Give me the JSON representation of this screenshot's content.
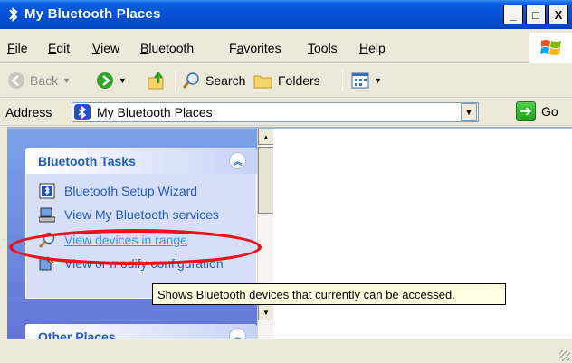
{
  "window": {
    "title": "My Bluetooth Places",
    "controls": {
      "minimize": "_",
      "maximize": "□",
      "close": "X"
    }
  },
  "menu": [
    {
      "label": "File",
      "underline": "F"
    },
    {
      "label": "Edit",
      "underline": "E"
    },
    {
      "label": "View",
      "underline": "V"
    },
    {
      "label": "Bluetooth",
      "underline": "B"
    },
    {
      "label": "Favorites",
      "underline": "a"
    },
    {
      "label": "Tools",
      "underline": "T"
    },
    {
      "label": "Help",
      "underline": "H"
    }
  ],
  "toolbar": {
    "back_label": "Back",
    "search_label": "Search",
    "folders_label": "Folders"
  },
  "address": {
    "label": "Address",
    "value": "My Bluetooth Places",
    "go_label": "Go"
  },
  "taskpane": {
    "bluetooth_tasks": {
      "title": "Bluetooth Tasks",
      "items": [
        {
          "label": "Bluetooth Setup Wizard",
          "icon": "setup-wizard-icon"
        },
        {
          "label": "View My Bluetooth services",
          "icon": "computer-icon"
        },
        {
          "label": "View devices in range",
          "icon": "magnifier-icon"
        },
        {
          "label": "View or modify configuration",
          "icon": "config-icon"
        }
      ]
    },
    "other_places": {
      "title": "Other Places"
    }
  },
  "tooltip": "Shows Bluetooth devices that currently can be accessed.",
  "colors": {
    "title_bar": "#0551d6",
    "task_link": "#215dc6",
    "task_pane_bg": "#6375d6",
    "highlight_ring": "#e8131b",
    "tooltip_bg": "#ffffe1"
  }
}
